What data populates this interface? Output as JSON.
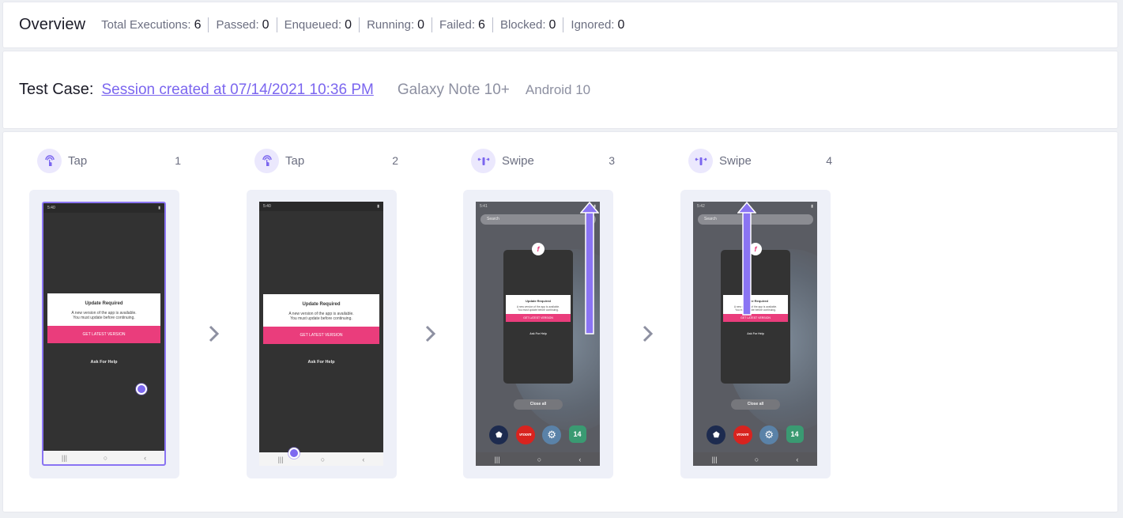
{
  "overview": {
    "title": "Overview",
    "stats": [
      {
        "label": "Total Executions:",
        "value": "6"
      },
      {
        "label": "Passed:",
        "value": "0"
      },
      {
        "label": "Enqueued:",
        "value": "0"
      },
      {
        "label": "Running:",
        "value": "0"
      },
      {
        "label": "Failed:",
        "value": "6"
      },
      {
        "label": "Blocked:",
        "value": "0"
      },
      {
        "label": "Ignored:",
        "value": "0"
      }
    ]
  },
  "test_case": {
    "label": "Test Case:",
    "session_link": "Session created at 07/14/2021 10:36 PM",
    "device": "Galaxy Note 10+",
    "os": "Android 10"
  },
  "colors": {
    "accent": "#7b66ef",
    "action_icon_bg": "#ebe8fd",
    "app_button": "#ea3d7c"
  },
  "steps": [
    {
      "action": "Tap",
      "icon": "touch-icon",
      "number": "1",
      "screen": {
        "time": "5:40",
        "dialog_title": "Update Required",
        "dialog_line1": "A new version of the app is available.",
        "dialog_line2": "You must update before continuing.",
        "button": "GET LATEST VERSION",
        "help": "Ask For Help"
      }
    },
    {
      "action": "Tap",
      "icon": "touch-icon",
      "number": "2",
      "screen": {
        "time": "5:40",
        "dialog_title": "Update Required",
        "dialog_line1": "A new version of the app is available.",
        "dialog_line2": "You must update before continuing.",
        "button": "GET LATEST VERSION",
        "help": "Ask For Help"
      }
    },
    {
      "action": "Swipe",
      "icon": "swipe-icon",
      "number": "3",
      "screen": {
        "time": "5:41",
        "search": "Search",
        "dialog_title": "Update Required",
        "dialog_line1": "A new version of the app is available.",
        "dialog_line2": "You must update before continuing.",
        "button": "GET LATEST VERSION",
        "help": "Ask For Help",
        "close_all": "Close all",
        "dock_vroom": "vroom",
        "dock_calendar": "14"
      }
    },
    {
      "action": "Swipe",
      "icon": "swipe-icon",
      "number": "4",
      "screen": {
        "time": "5:42",
        "search": "Search",
        "dialog_title": "Update Required",
        "dialog_line1": "A new version of the app is available.",
        "dialog_line2": "You must update before continuing.",
        "button": "GET LATEST VERSION",
        "help": "Ask For Help",
        "close_all": "Close all",
        "dock_vroom": "vroom",
        "dock_calendar": "14"
      }
    }
  ]
}
